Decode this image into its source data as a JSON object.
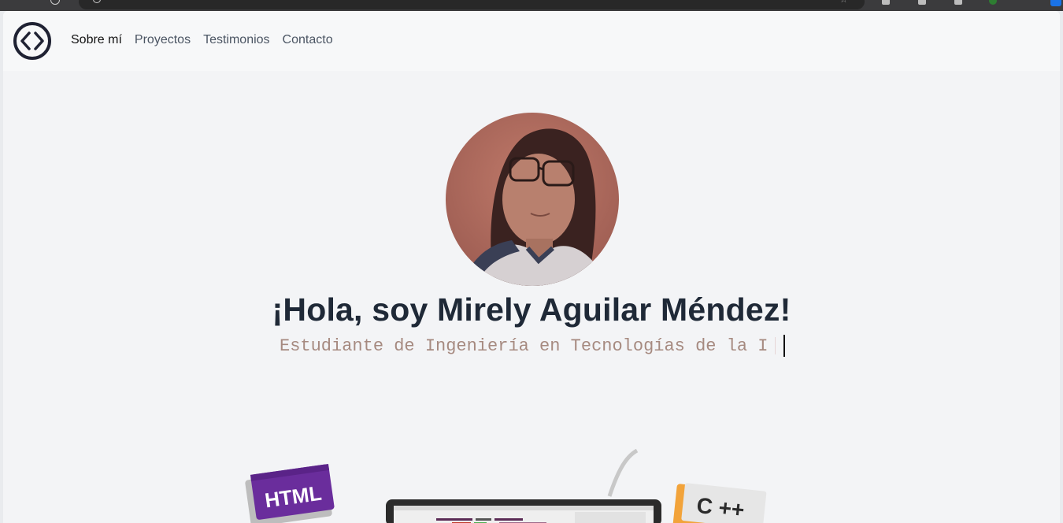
{
  "nav": {
    "logo_icon": "code-brackets-icon",
    "links": [
      {
        "label": "Sobre mí",
        "active": true
      },
      {
        "label": "Proyectos",
        "active": false
      },
      {
        "label": "Testimonios",
        "active": false
      },
      {
        "label": "Contacto",
        "active": false
      }
    ]
  },
  "hero": {
    "photo_icon": "profile-photo",
    "title": "¡Hola, soy Mirely Aguilar Méndez!",
    "subtitle": "Estudiante de Ingeniería en Tecnologías de la I"
  },
  "illustration": {
    "html_badge": "HTML",
    "cpp_badge": "C ++"
  },
  "colors": {
    "page_bg": "#f3f4f6",
    "title": "#1f2937",
    "subtitle": "#a68a80",
    "html_purple": "#6a2d9c",
    "cpp_orange": "#f2a33a"
  }
}
